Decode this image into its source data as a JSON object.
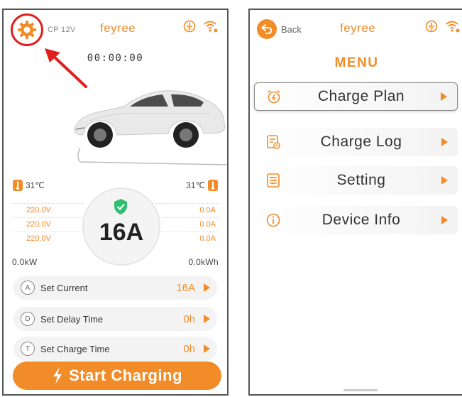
{
  "left_screen": {
    "cp_label": "CP 12V",
    "brand": "feyree",
    "timer": "00:00:00",
    "temp_left": "31℃",
    "temp_right": "31℃",
    "voltages": [
      "220.0V",
      "220.0V",
      "220.0V"
    ],
    "currents": [
      "0.0A",
      "0.0A",
      "0.0A"
    ],
    "power_kw": "0.0kW",
    "energy_kwh": "0.0kWh",
    "current_setting": "16A",
    "settings": [
      {
        "badge": "A",
        "label": "Set Current",
        "value": "16A"
      },
      {
        "badge": "D",
        "label": "Set Delay Time",
        "value": "0h"
      },
      {
        "badge": "T",
        "label": "Set Charge Time",
        "value": "0h"
      }
    ],
    "start_button": "Start Charging"
  },
  "right_screen": {
    "back_label": "Back",
    "brand": "feyree",
    "menu_title": "MENU",
    "menu_items": [
      {
        "label": "Charge Plan",
        "icon": "alarm-clock-icon"
      },
      {
        "label": "Charge Log",
        "icon": "log-icon"
      },
      {
        "label": "Setting",
        "icon": "settings-list-icon"
      },
      {
        "label": "Device Info",
        "icon": "info-icon"
      }
    ]
  },
  "colors": {
    "accent": "#f28c28",
    "highlight_ring": "#e0201e",
    "shield_green": "#2fbf71"
  }
}
